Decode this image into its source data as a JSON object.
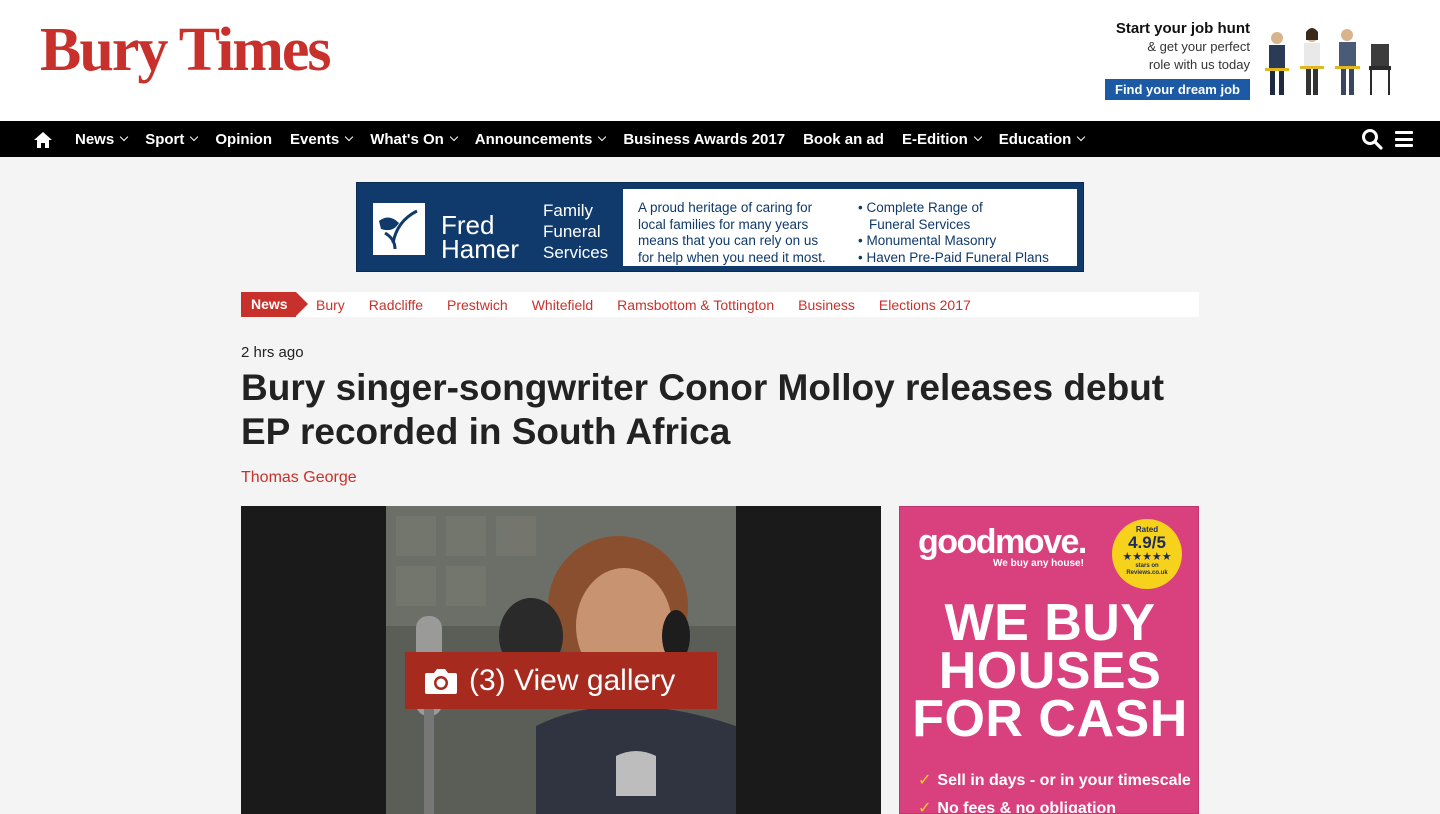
{
  "header": {
    "logo": "Bury Times",
    "job_ad": {
      "title": "Start your job hunt",
      "line1": "& get your perfect",
      "line2": "role with us today",
      "button": "Find your dream job"
    }
  },
  "nav": {
    "items": [
      {
        "label": "News",
        "dropdown": true
      },
      {
        "label": "Sport",
        "dropdown": true
      },
      {
        "label": "Opinion",
        "dropdown": false
      },
      {
        "label": "Events",
        "dropdown": true
      },
      {
        "label": "What's On",
        "dropdown": true
      },
      {
        "label": "Announcements",
        "dropdown": true
      },
      {
        "label": "Business Awards 2017",
        "dropdown": false
      },
      {
        "label": "Book an ad",
        "dropdown": false
      },
      {
        "label": "E-Edition",
        "dropdown": true
      },
      {
        "label": "Education",
        "dropdown": true
      }
    ]
  },
  "banner": {
    "name_line1": "Fred",
    "name_line2": "Hamer",
    "serv_line1": "Family",
    "serv_line2": "Funeral",
    "serv_line3": "Services",
    "copy_1": "A proud heritage of caring for",
    "copy_2": "local families for many years",
    "copy_3": "means that you can rely on us",
    "copy_4": "for help when you need it most.",
    "list_1": "• Complete Range of",
    "list_2": "Funeral Services",
    "list_3": "• Monumental Masonry",
    "list_4": "• Haven Pre-Paid Funeral Plans"
  },
  "subnav": {
    "section": "News",
    "items": [
      "Bury",
      "Radcliffe",
      "Prestwich",
      "Whitefield",
      "Ramsbottom & Tottington",
      "Business",
      "Elections 2017"
    ]
  },
  "article": {
    "timestamp": "2 hrs ago",
    "headline": "Bury singer-songwriter Conor Molloy releases debut EP recorded in South Africa",
    "author": "Thomas George",
    "gallery_label": "(3) View gallery"
  },
  "ad": {
    "logo": "goodmove.",
    "tagline": "We buy any house!",
    "rated": "Rated",
    "score": "4.9/5",
    "stars": "★★★★★",
    "badge_small1": "stars on",
    "badge_small2": "Reviews.co.uk",
    "headline_1": "WE BUY",
    "headline_2": "HOUSES",
    "headline_3": "FOR CASH",
    "bullet_1": "Sell in days - or in your timescale",
    "bullet_2": "No fees & no obligation"
  },
  "colors": {
    "brand": "#c8312b",
    "nav_bg": "#000000",
    "banner_bg": "#0f3a6b",
    "ad_bg": "#d9407e",
    "job_btn": "#1d5aa6"
  }
}
